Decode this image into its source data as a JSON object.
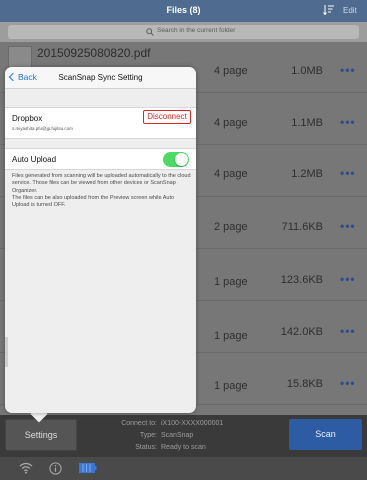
{
  "header": {
    "title": "Files (8)",
    "edit_label": "Edit"
  },
  "search": {
    "placeholder": "Search in the current folder"
  },
  "files": [
    {
      "name": "20150925080820.pdf",
      "pages": "4 page",
      "size": "1.0MB"
    },
    {
      "name": "",
      "pages": "4 page",
      "size": "1.1MB"
    },
    {
      "name": "",
      "pages": "4 page",
      "size": "1.2MB"
    },
    {
      "name": "",
      "pages": "2 page",
      "size": "711.6KB"
    },
    {
      "name": "",
      "pages": "1 page",
      "size": "123.6KB"
    },
    {
      "name": "",
      "pages": "1 page",
      "size": "142.0KB"
    },
    {
      "name": "",
      "pages": "1 page",
      "size": "15.8KB"
    }
  ],
  "more_glyph": "•••",
  "popover": {
    "back_label": "Back",
    "title": "ScanSnap Sync Setting",
    "dropbox": {
      "name": "Dropbox",
      "email": "s.miyashita.pfu@jp.fujitsu.com",
      "disconnect_label": "Disconnect"
    },
    "auto_upload": {
      "label": "Auto Upload",
      "enabled": true
    },
    "description_1": "Files generated from scanning will be uploaded automatically to the cloud service. Those files can be viewed from other devices or ScanSnap Organizer.",
    "description_2": "The files can be also uploaded from the Preview screen while Auto Upload is turned OFF."
  },
  "panel": {
    "settings_label": "Settings",
    "connect_label": "Connect to:",
    "connect_value": "iX100-XXXX000001",
    "type_label": "Type:",
    "type_value": "ScanSnap",
    "status_label": "Status:",
    "status_value": "Ready to scan",
    "scan_label": "Scan"
  },
  "statusbar": {
    "icons": [
      "wifi-icon",
      "info-icon",
      "battery-icon"
    ]
  },
  "colors": {
    "nav": "#4f6b8f",
    "accent": "#2277e0",
    "toggle_on": "#4cd964",
    "disconnect": "#d52a2a",
    "scan": "#2d5ca5"
  }
}
